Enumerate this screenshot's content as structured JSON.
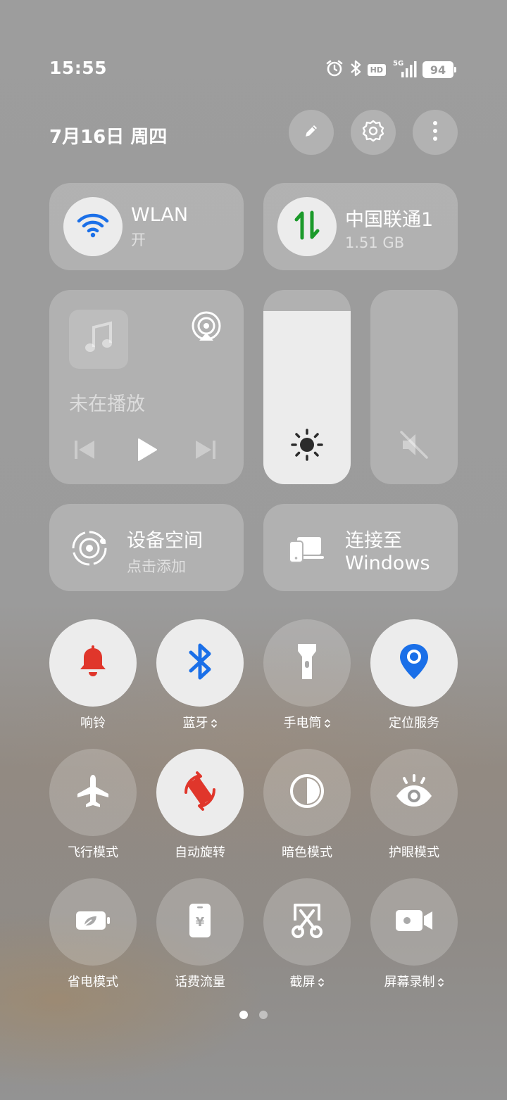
{
  "status_bar": {
    "time": "15:55",
    "hd_label": "HD",
    "network_label": "5G",
    "battery": "94",
    "icons": [
      "alarm-icon",
      "bluetooth-icon",
      "hd-icon",
      "signal-icon",
      "battery-icon"
    ]
  },
  "header": {
    "date": "7月16日 周四",
    "buttons": [
      "edit-icon",
      "settings-icon",
      "more-icon"
    ]
  },
  "wlan": {
    "title": "WLAN",
    "status": "开",
    "accent": "#1a6fe8"
  },
  "mobile_data": {
    "title": "中国联通1",
    "usage": "1.51 GB",
    "accent": "#1b9a2a"
  },
  "media": {
    "status": "未在播放"
  },
  "brightness": {
    "level": 0.89
  },
  "volume": {
    "muted": true
  },
  "device_space": {
    "title": "设备空间",
    "subtitle": "点击添加"
  },
  "connect_windows": {
    "title_line1": "连接至",
    "title_line2": "Windows"
  },
  "toggles": [
    {
      "label": "响铃",
      "icon": "bell-icon",
      "active": true,
      "expandable": false
    },
    {
      "label": "蓝牙",
      "icon": "bluetooth-icon",
      "active": true,
      "expandable": true
    },
    {
      "label": "手电筒",
      "icon": "flashlight-icon",
      "active": false,
      "expandable": true
    },
    {
      "label": "定位服务",
      "icon": "location-icon",
      "active": true,
      "expandable": false
    },
    {
      "label": "飞行模式",
      "icon": "airplane-icon",
      "active": false,
      "expandable": false
    },
    {
      "label": "自动旋转",
      "icon": "auto-rotate-icon",
      "active": true,
      "expandable": false
    },
    {
      "label": "暗色模式",
      "icon": "dark-mode-icon",
      "active": false,
      "expandable": false
    },
    {
      "label": "护眼模式",
      "icon": "eye-comfort-icon",
      "active": false,
      "expandable": false
    },
    {
      "label": "省电模式",
      "icon": "battery-saver-icon",
      "active": false,
      "expandable": false
    },
    {
      "label": "话费流量",
      "icon": "phone-bill-icon",
      "active": false,
      "expandable": false
    },
    {
      "label": "截屏",
      "icon": "screenshot-icon",
      "active": false,
      "expandable": true
    },
    {
      "label": "屏幕录制",
      "icon": "screen-record-icon",
      "active": false,
      "expandable": true
    }
  ],
  "pagination": {
    "current": 1,
    "total": 2
  },
  "colors": {
    "red": "#e0362b",
    "blue": "#1a6fe8",
    "green": "#1b9a2a"
  }
}
